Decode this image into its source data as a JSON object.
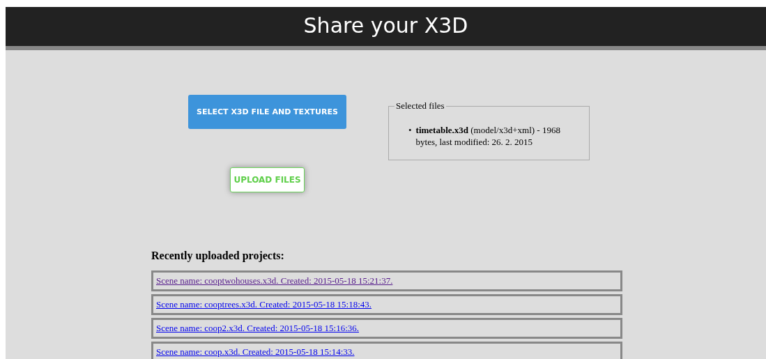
{
  "header": {
    "title": "Share your X3D"
  },
  "upload": {
    "select_button": "SELECT X3D FILE AND TEXTURES",
    "upload_button": "UPLOAD FILES"
  },
  "selected_files": {
    "legend": "Selected files",
    "files": [
      {
        "bullet": "•",
        "name": "timetable.x3d",
        "details": "(model/x3d+xml) - 1968 bytes, last modified: 26. 2. 2015"
      }
    ]
  },
  "recent": {
    "heading": "Recently uploaded projects:",
    "projects": [
      {
        "label": "Scene name: cooptwohouses.x3d. Created: 2015-05-18 15:21:37.",
        "visited": true
      },
      {
        "label": "Scene name: cooptrees.x3d. Created: 2015-05-18 15:18:43.",
        "visited": false
      },
      {
        "label": "Scene name: coop2.x3d. Created: 2015-05-18 15:16:36.",
        "visited": false
      },
      {
        "label": "Scene name: coop.x3d. Created: 2015-05-18 15:14:33.",
        "visited": false
      }
    ]
  }
}
